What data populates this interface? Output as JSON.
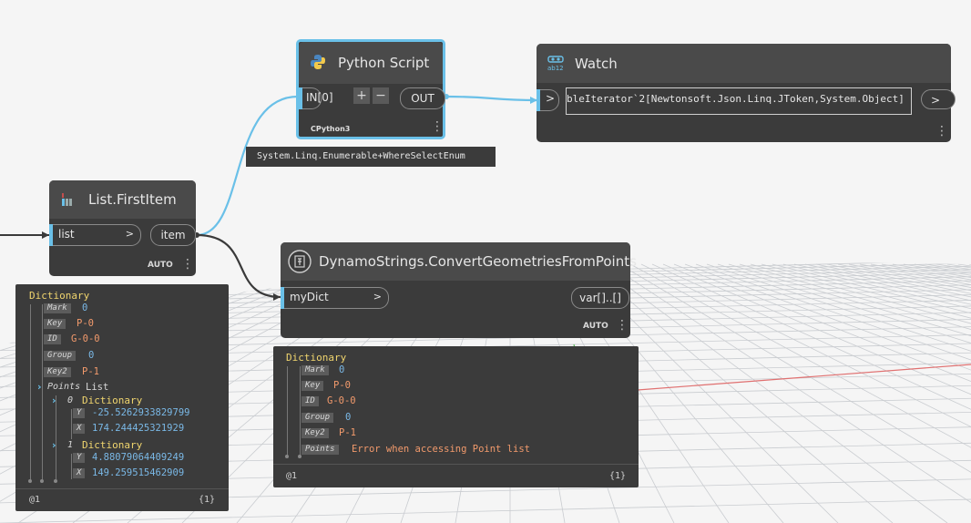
{
  "python_node": {
    "title": "Python Script",
    "input_port": "IN[0]",
    "add_label": "+",
    "remove_label": "−",
    "output_port": "OUT",
    "engine": "CPython3",
    "preview": "System.Linq.Enumerable+WhereSelectEnum"
  },
  "watch_node": {
    "title": "Watch",
    "input_chevron": ">",
    "value": "bleIterator`2[Newtonsoft.Json.Linq.JToken,System.Object]",
    "output_chevron": ">"
  },
  "firstitem_node": {
    "title": "List.FirstItem",
    "input_port": "list",
    "input_chevron": ">",
    "output_port": "item",
    "lacing": "AUTO"
  },
  "convert_node": {
    "title": "DynamoStrings.ConvertGeometriesFromPoints",
    "input_port": "myDict",
    "input_chevron": ">",
    "output_port": "var[]..[]",
    "lacing": "AUTO"
  },
  "preview_left": {
    "title": "Dictionary",
    "entries": [
      {
        "key": "Mark",
        "value": "0"
      },
      {
        "key": "Key",
        "value": "P-0"
      },
      {
        "key": "ID",
        "value": "G-0-0"
      },
      {
        "key": "Group",
        "value": "0"
      },
      {
        "key": "Key2",
        "value": "P-1"
      }
    ],
    "points_key": "Points",
    "points_type": "List",
    "items": [
      {
        "index": "0",
        "type": "Dictionary",
        "y_key": "Y",
        "y": "-25.5262933829799",
        "x_key": "X",
        "x": "174.244425321929"
      },
      {
        "index": "1",
        "type": "Dictionary",
        "y_key": "Y",
        "y": "4.88079064409249",
        "x_key": "X",
        "x": "149.259515462909"
      }
    ],
    "level": "@1",
    "count": "{1}"
  },
  "preview_right": {
    "title": "Dictionary",
    "entries": [
      {
        "key": "Mark",
        "value": "0"
      },
      {
        "key": "Key",
        "value": "P-0"
      },
      {
        "key": "ID",
        "value": "G-0-0"
      },
      {
        "key": "Group",
        "value": "0"
      },
      {
        "key": "Key2",
        "value": "P-1"
      },
      {
        "key": "Points",
        "value": "Error when accessing Point list"
      }
    ],
    "level": "@1",
    "count": "{1}"
  },
  "colors": {
    "node_body": "#3b3b3b",
    "node_header": "#4a4a4a",
    "selection": "#6ac0e8",
    "wire": "#6ac0e8",
    "wire_dark": "#3a3a3a",
    "dict_title": "#f0d56e",
    "string_value": "#f29a6c",
    "number_value": "#7ab8e6"
  }
}
